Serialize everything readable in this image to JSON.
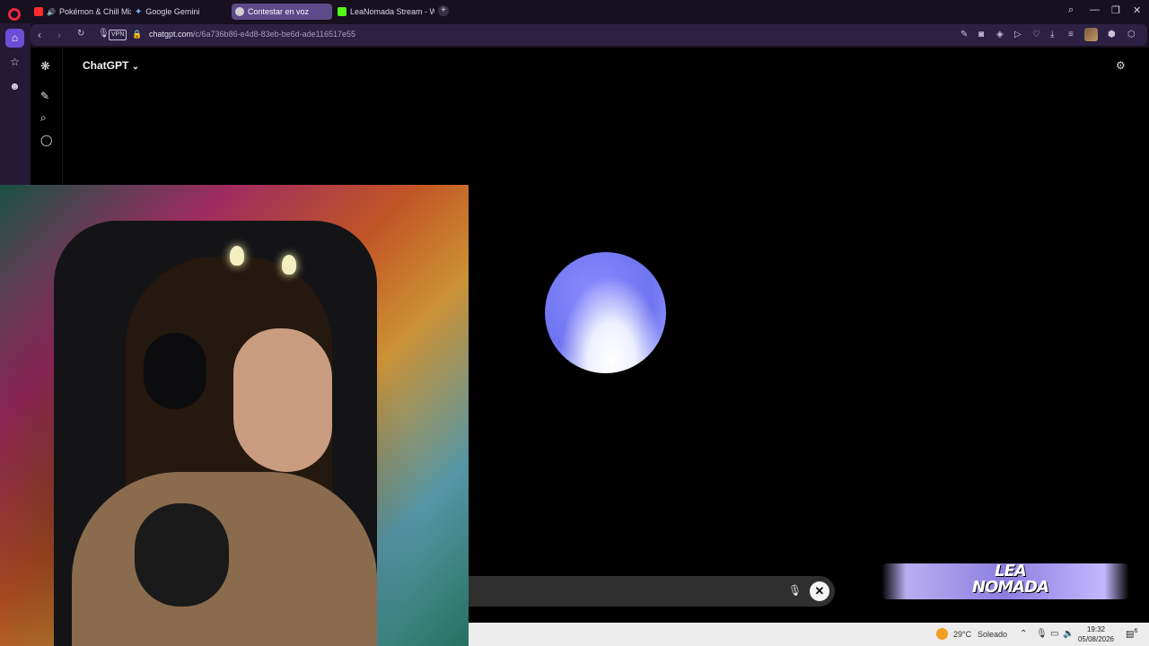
{
  "browser": {
    "tabs": [
      {
        "label": "Pokémon & Chill Mix |",
        "favicon_color": "#ff2b2b"
      },
      {
        "label": "Google Gemini",
        "favicon_color": "#7ab4ff"
      },
      {
        "label": "Contestar en voz",
        "favicon_color": "#d0d0d0"
      },
      {
        "label": "LeaNomada Stream - Wat",
        "favicon_color": "#53fc18"
      }
    ],
    "new_tab_icon": "plus-icon",
    "url_host": "chatgpt.com",
    "url_path": "/c/6a736b86-e4d8-83eb-be6d-ade116517e55",
    "vpn_label": "VPN"
  },
  "chatgpt": {
    "title": "ChatGPT",
    "title_chevron": "⌄"
  },
  "overlay": {
    "logo_line1": "LEA",
    "logo_line2": "NOMADA"
  },
  "taskbar": {
    "temperature": "29°C",
    "weather": "Soleado",
    "time": "19:32",
    "date": "05/08/2026",
    "notification_count": "6"
  },
  "colors": {
    "orb": "#7a7ff5",
    "active_tab": "#5d4a8a",
    "sidebar_active": "#6a4fd6"
  }
}
